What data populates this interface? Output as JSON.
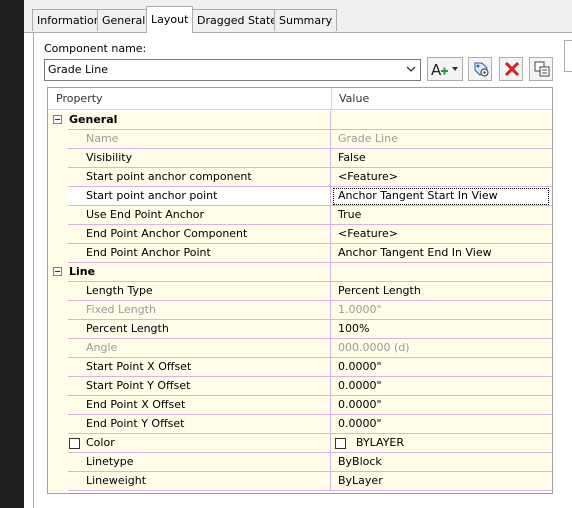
{
  "tabs": [
    {
      "label": "Information",
      "active": false
    },
    {
      "label": "General",
      "active": false
    },
    {
      "label": "Layout",
      "active": true
    },
    {
      "label": "Dragged State",
      "active": false
    },
    {
      "label": "Summary",
      "active": false
    }
  ],
  "component": {
    "label": "Component name:",
    "value": "Grade Line"
  },
  "toolbar": {
    "add_icon": "add-component-icon",
    "settings_icon": "component-settings-icon",
    "delete_icon": "delete-icon",
    "copy_icon": "copy-icon",
    "accent_red": "#d62020",
    "accent_green": "#1f9e3a",
    "accent_blue": "#1e5fb4"
  },
  "grid": {
    "headers": {
      "property": "Property",
      "value": "Value"
    },
    "categories": {
      "general": "General",
      "line": "Line"
    },
    "rows": {
      "name": {
        "label": "Name",
        "value": "Grade Line"
      },
      "visibility": {
        "label": "Visibility",
        "value": "False"
      },
      "start_anchor_component": {
        "label": "Start point anchor component",
        "value": "<Feature>"
      },
      "start_anchor_point": {
        "label": "Start point anchor point",
        "value": "Anchor Tangent Start In View"
      },
      "use_end_point_anchor": {
        "label": "Use End Point Anchor",
        "value": "True"
      },
      "end_anchor_component": {
        "label": "End Point Anchor Component",
        "value": "<Feature>"
      },
      "end_anchor_point": {
        "label": "End Point Anchor Point",
        "value": "Anchor Tangent End In View"
      },
      "length_type": {
        "label": "Length Type",
        "value": "Percent Length"
      },
      "fixed_length": {
        "label": "Fixed Length",
        "value": "1.0000\""
      },
      "percent_length": {
        "label": "Percent Length",
        "value": "100%"
      },
      "angle": {
        "label": "Angle",
        "value": "000.0000 (d)"
      },
      "start_x_offset": {
        "label": "Start Point X Offset",
        "value": "0.0000\""
      },
      "start_y_offset": {
        "label": "Start Point Y Offset",
        "value": "0.0000\""
      },
      "end_x_offset": {
        "label": "End Point X Offset",
        "value": "0.0000\""
      },
      "end_y_offset": {
        "label": "End Point Y Offset",
        "value": "0.0000\""
      },
      "color": {
        "label": "Color",
        "value": "BYLAYER"
      },
      "linetype": {
        "label": "Linetype",
        "value": "ByBlock"
      },
      "lineweight": {
        "label": "Lineweight",
        "value": "ByLayer"
      }
    }
  }
}
